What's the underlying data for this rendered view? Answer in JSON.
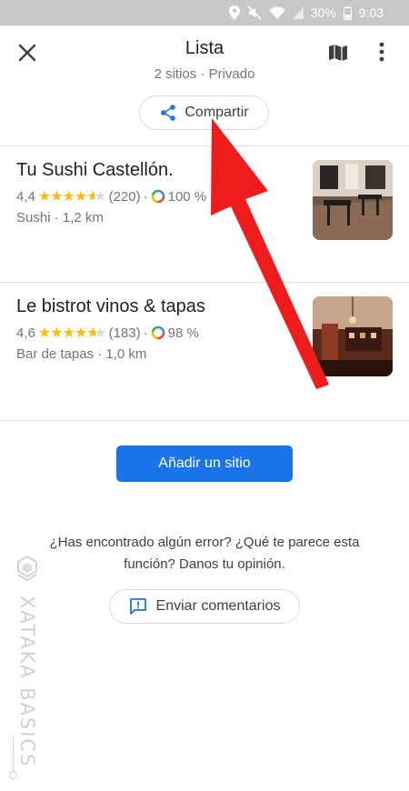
{
  "status_bar": {
    "battery": "30%",
    "time": "9:03"
  },
  "header": {
    "title": "Lista",
    "subtitle": "2 sitios · Privado",
    "share_label": "Compartir",
    "icons": {
      "close": "close-icon",
      "map": "map-icon",
      "more": "more-vert-icon",
      "share": "share-icon"
    }
  },
  "places": [
    {
      "name": "Tu Sushi Castellón.",
      "rating": "4,4",
      "stars": 4.5,
      "reviews": "(220)",
      "score": "100 %",
      "type": "Sushi · 1,2 km"
    },
    {
      "name": "Le bistrot vinos & tapas",
      "rating": "4,6",
      "stars": 4.5,
      "reviews": "(183)",
      "score": "98 %",
      "type": "Bar de tapas · 1,0 km"
    }
  ],
  "add_button": "Añadir un sitio",
  "feedback": {
    "text": "¿Has encontrado algún error? ¿Qué te parece esta función? Danos tu opinión.",
    "button": "Enviar comentarios"
  },
  "watermark": "XATAKA BASICS",
  "colors": {
    "accent": "#1a73e8",
    "star": "#fbbc04",
    "arrow": "#ee1c1c"
  }
}
